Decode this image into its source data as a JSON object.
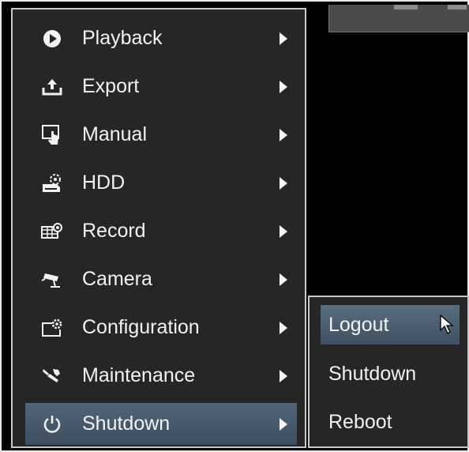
{
  "main_menu": {
    "items": [
      {
        "label": "Playback",
        "icon": "playback-icon"
      },
      {
        "label": "Export",
        "icon": "export-icon"
      },
      {
        "label": "Manual",
        "icon": "manual-icon"
      },
      {
        "label": "HDD",
        "icon": "hdd-icon"
      },
      {
        "label": "Record",
        "icon": "record-icon"
      },
      {
        "label": "Camera",
        "icon": "camera-icon"
      },
      {
        "label": "Configuration",
        "icon": "configuration-icon"
      },
      {
        "label": "Maintenance",
        "icon": "maintenance-icon"
      },
      {
        "label": "Shutdown",
        "icon": "power-icon",
        "selected": true
      }
    ]
  },
  "shutdown_submenu": {
    "items": [
      {
        "label": "Logout",
        "selected": true
      },
      {
        "label": "Shutdown"
      },
      {
        "label": "Reboot"
      }
    ]
  },
  "colors": {
    "menu_background": "#262626",
    "selection_highlight": "#4a5d70",
    "text": "#f2f2f2",
    "border": "#c9c9c9"
  }
}
